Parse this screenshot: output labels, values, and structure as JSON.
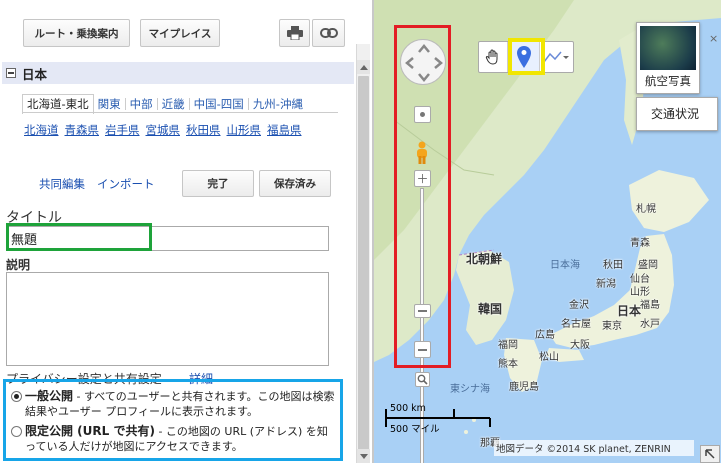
{
  "toolbar": {
    "route_label": "ルート・乗換案内",
    "myplaces_label": "マイプレイス",
    "print_icon": "print-icon",
    "link_icon": "link-icon"
  },
  "region": {
    "title": "日本",
    "tabs": [
      "北海道-東北",
      "関東",
      "中部",
      "近畿",
      "中国-四国",
      "九州-沖縄"
    ],
    "active_tab": "北海道-東北",
    "prefectures": [
      "北海道",
      "青森県",
      "岩手県",
      "宮城県",
      "秋田県",
      "山形県",
      "福島県"
    ]
  },
  "edit": {
    "collab_label": "共同編集",
    "import_label": "インポート",
    "done_label": "完了",
    "saved_label": "保存済み"
  },
  "form": {
    "title_label": "タイトル",
    "title_value": "無題",
    "description_label": "説明",
    "description_value": ""
  },
  "privacy": {
    "heading": "プライバシー設定と共有設定",
    "details_link": "詳細",
    "public_title": "一般公開",
    "public_desc": " - すべてのユーザーと共有されます。この地図は検索結果やユーザー プロフィールに表示されます。",
    "unlisted_title": "限定公開 (URL で共有)",
    "unlisted_desc": " - この地図の URL (アドレス) を知っている人だけが地図にアクセスできます。",
    "selected": "public"
  },
  "map": {
    "satellite_label": "航空写真",
    "traffic_label": "交通状況",
    "scale_km": "500 km",
    "scale_mile": "500 マイル",
    "copyright": "地図データ ©2014 SK planet, ZENRIN",
    "labels": {
      "north_korea": "北朝鮮",
      "south_korea": "韓国",
      "japan": "日本",
      "sea_of_japan": "日本海",
      "east_china_sea": "東シナ海",
      "sapporo": "札幌",
      "aomori": "青森",
      "akita": "秋田",
      "morioka": "盛岡",
      "sendai": "仙台",
      "yamagata": "山形",
      "niigata": "新潟",
      "fukushima": "福島",
      "kanazawa": "金沢",
      "nagoya": "名古屋",
      "tokyo": "東京",
      "mito": "水戸",
      "hiroshima": "広島",
      "osaka": "大阪",
      "fukuoka": "福岡",
      "kumamoto": "熊本",
      "matsuyama": "松山",
      "kagoshima": "鹿児島",
      "naha": "那覇"
    }
  },
  "colors": {
    "highlight_red": "#e31d24",
    "highlight_yellow": "#f1e600",
    "highlight_green": "#1ea33a",
    "highlight_blue": "#17a5e8",
    "link": "#1a4fb0"
  }
}
